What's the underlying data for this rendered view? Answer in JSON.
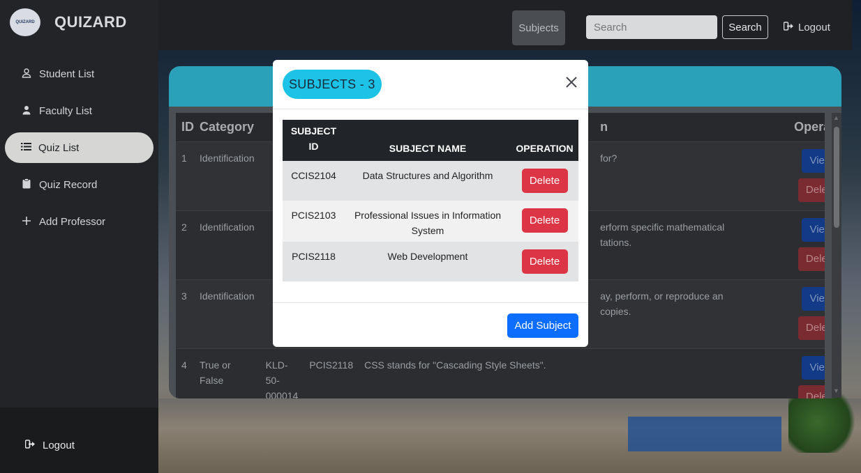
{
  "brand": {
    "name": "QUIZARD",
    "logo_text": "QUIZARD"
  },
  "sidebar": {
    "items": [
      {
        "label": "Student List",
        "icon": "user-icon"
      },
      {
        "label": "Faculty List",
        "icon": "user-tie-icon"
      },
      {
        "label": "Quiz List",
        "icon": "list-icon"
      },
      {
        "label": "Quiz Record",
        "icon": "clipboard-icon"
      },
      {
        "label": "Add Professor",
        "icon": "plus-icon"
      }
    ],
    "logout_label": "Logout"
  },
  "topbar": {
    "subjects_label": "Subjects",
    "search_placeholder": "Search",
    "search_button": "Search",
    "logout_label": "Logout"
  },
  "quiz_table": {
    "headers": {
      "id": "ID",
      "category": "Category",
      "question_tail": "n",
      "operation": "Operation"
    },
    "rows": [
      {
        "id": "1",
        "category": "Identification",
        "question_tail": "for?",
        "view": "View",
        "delete": "Delete"
      },
      {
        "id": "2",
        "category": "Identification",
        "question_tail": "erform specific mathematical\ntations.",
        "view": "View",
        "delete": "Delete"
      },
      {
        "id": "3",
        "category": "Identification",
        "question_tail": "ay, perform, or reproduce an\ncopies.",
        "view": "View",
        "delete": "Delete"
      },
      {
        "id": "4",
        "category": "True or False",
        "code": "KLD-50-\n000014",
        "subject": "PCIS2118",
        "question": "CSS stands for \"Cascading Style Sheets\".",
        "view": "View",
        "delete": "Delete"
      }
    ]
  },
  "modal": {
    "title": "SUBJECTS - 3",
    "headers": {
      "id": "SUBJECT\nID",
      "name": "SUBJECT NAME",
      "operation": "OPERATION"
    },
    "rows": [
      {
        "id": "CCIS2104",
        "name": "Data Structures and Algorithm",
        "action": "Delete"
      },
      {
        "id": "PCIS2103",
        "name": "Professional Issues in Information System",
        "action": "Delete"
      },
      {
        "id": "PCIS2118",
        "name": "Web Development",
        "action": "Delete"
      }
    ],
    "add_button": "Add Subject"
  }
}
